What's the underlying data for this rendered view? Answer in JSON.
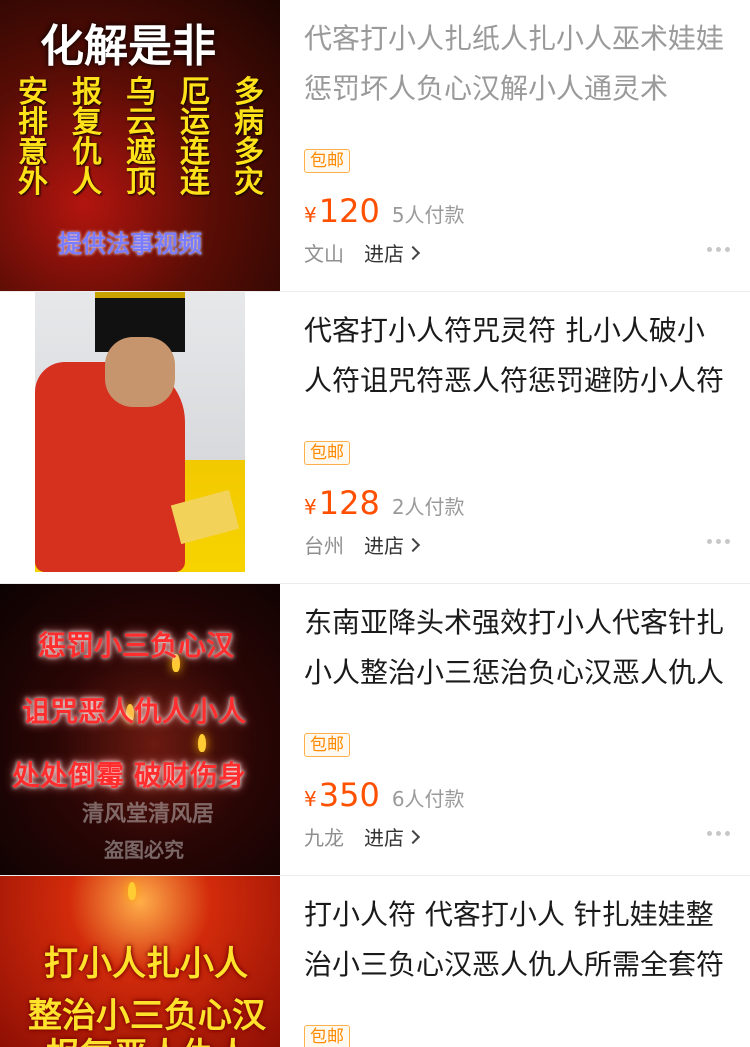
{
  "items": [
    {
      "title_lines": [
        "代客打小人扎纸人扎小人巫术娃娃",
        "惩罚坏人负心汉解小人通灵术"
      ],
      "tag": "包邮",
      "currency": "¥",
      "price": "120",
      "paid": "5人付款",
      "location": "文山",
      "store_label": "进店",
      "thumb": {
        "headline": "化解是非",
        "columns": [
          [
            "安",
            "排",
            "意",
            "外"
          ],
          [
            "报",
            "复",
            "仇",
            "人"
          ],
          [
            "乌",
            "云",
            "遮",
            "顶"
          ],
          [
            "厄",
            "运",
            "连",
            "连"
          ],
          [
            "多",
            "病",
            "多",
            "灾"
          ]
        ],
        "footer": "提供法事视频"
      }
    },
    {
      "title_lines": [
        "代客打小人符咒灵符 扎小人破小",
        "人符诅咒符恶人符惩罚避防小人符"
      ],
      "tag": "包邮",
      "currency": "¥",
      "price": "128",
      "paid": "2人付款",
      "location": "台州",
      "store_label": "进店"
    },
    {
      "title_lines": [
        "东南亚降头术强效打小人代客针扎",
        "小人整治小三惩治负心汉恶人仇人"
      ],
      "tag": "包邮",
      "currency": "¥",
      "price": "350",
      "paid": "6人付款",
      "location": "九龙",
      "store_label": "进店",
      "thumb": {
        "line1": "惩罚小三负心汉",
        "line2": "诅咒恶人仇人小人",
        "line3": "处处倒霉 破财伤身",
        "watermark1": "清风堂清风居",
        "watermark2": "盗图必究"
      }
    },
    {
      "title_lines": [
        "打小人符 代客打小人 针扎娃娃整",
        "治小三负心汉恶人仇人所需全套符"
      ],
      "tag": "包邮",
      "thumb": {
        "line1": "打小人扎小人",
        "line2": "整治小三负心汉",
        "line3": "报复恶人仇人"
      }
    }
  ],
  "icons": {
    "more": "more-dots-icon",
    "chevron": "chevron-right-icon"
  },
  "colors": {
    "price": "#ff5000",
    "tag": "#ff8a00"
  }
}
